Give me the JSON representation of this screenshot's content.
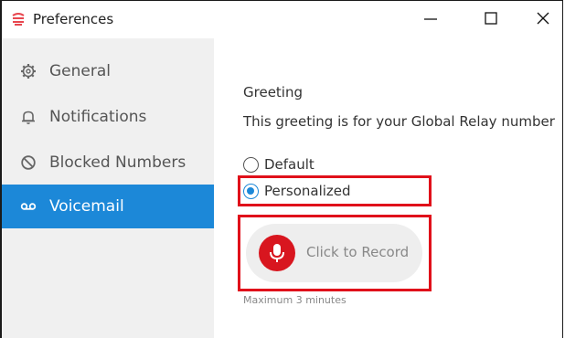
{
  "window": {
    "title": "Preferences",
    "controls": {
      "minimize": "minimize-icon",
      "maximize": "maximize-icon",
      "close": "close-icon"
    }
  },
  "sidebar": {
    "items": [
      {
        "label": "General",
        "icon": "gear-icon",
        "active": false
      },
      {
        "label": "Notifications",
        "icon": "bell-icon",
        "active": false
      },
      {
        "label": "Blocked Numbers",
        "icon": "block-icon",
        "active": false
      },
      {
        "label": "Voicemail",
        "icon": "voicemail-icon",
        "active": true
      }
    ]
  },
  "main": {
    "section_title": "Greeting",
    "description": "This greeting is for your Global Relay number",
    "options": [
      {
        "label": "Default",
        "selected": false
      },
      {
        "label": "Personalized",
        "selected": true
      }
    ],
    "record_button": {
      "label": "Click to Record",
      "icon": "microphone-icon"
    },
    "max_note": "Maximum 3 minutes"
  },
  "colors": {
    "accent": "#1c88d8",
    "record_red": "#d8161f",
    "highlight_box": "#e0101a",
    "sidebar_bg": "#f0f0f0",
    "app_icon": "#e8474f"
  }
}
